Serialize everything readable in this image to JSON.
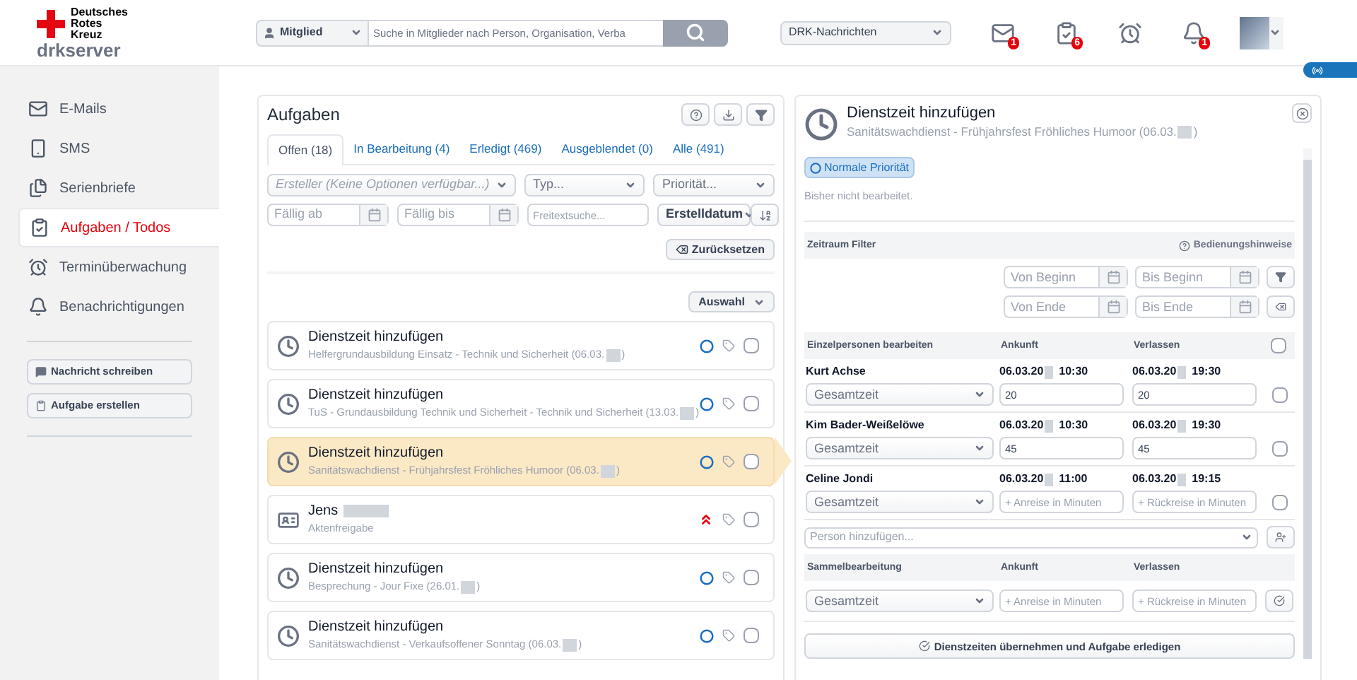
{
  "header": {
    "logo": {
      "lines": [
        "Deutsches",
        "Rotes",
        "Kreuz"
      ],
      "brand": "drkserver"
    },
    "search": {
      "scope": "Mitglied",
      "placeholder": "Suche in Mitglieder nach Person, Organisation, Verba"
    },
    "news_select": "DRK-Nachrichten",
    "notifications": [
      {
        "kind": "mail",
        "badge": "1"
      },
      {
        "kind": "tasks",
        "badge": "6"
      },
      {
        "kind": "alarm"
      },
      {
        "kind": "bell",
        "badge": "1"
      }
    ]
  },
  "sidebar": {
    "items": [
      {
        "kind": "mail",
        "label": "E-Mails",
        "selected": false
      },
      {
        "kind": "sms",
        "label": "SMS",
        "selected": false
      },
      {
        "kind": "letters",
        "label": "Serienbriefe",
        "selected": false
      },
      {
        "kind": "tasks",
        "label": "Aufgaben / Todos",
        "selected": true
      },
      {
        "kind": "alarm",
        "label": "Terminüberwachung",
        "selected": false
      },
      {
        "kind": "bell",
        "label": "Benachrichtigungen",
        "selected": false
      }
    ],
    "buttons": [
      {
        "kind": "message",
        "label": "Nachricht schreiben"
      },
      {
        "kind": "task",
        "label": "Aufgabe erstellen"
      }
    ]
  },
  "tasks": {
    "title": "Aufgaben",
    "tabs": [
      {
        "label": "Offen (18)",
        "selected": true
      },
      {
        "label": "In Bearbeitung (4)",
        "selected": false
      },
      {
        "label": "Erledigt (469)",
        "selected": false
      },
      {
        "label": "Ausgeblendet (0)",
        "selected": false
      },
      {
        "label": "Alle (491)",
        "selected": false
      }
    ],
    "filters": {
      "creator": "Ersteller (Keine Optionen verfügbar...)",
      "type": "Typ...",
      "priority": "Priorität...",
      "due_from_placeholder": "Fällig ab",
      "due_to_placeholder": "Fällig bis",
      "fulltext_placeholder": "Freitextsuche...",
      "sort": "Erstelldatum",
      "reset": "Zurücksetzen"
    },
    "selection": "Auswahl",
    "items": [
      {
        "kind": "time",
        "title": "Dienstzeit hinzufügen",
        "subtitle": "Helfergrundausbildung Einsatz - Technik und Sicherheit (06.03.",
        "subtitle_end": ")",
        "high_priority": false,
        "selected": false,
        "checked": false
      },
      {
        "kind": "time",
        "title": "Dienstzeit hinzufügen",
        "subtitle": "TuS - Grundausbildung Technik und Sicherheit - Technik und Sicherheit (13.03.",
        "subtitle_end": ")",
        "high_priority": false,
        "selected": false,
        "checked": false
      },
      {
        "kind": "time",
        "title": "Dienstzeit hinzufügen",
        "subtitle": "Sanitätswachdienst - Frühjahrsfest Fröhliches Humoor (06.03.",
        "subtitle_end": ")",
        "high_priority": false,
        "selected": true,
        "checked": false
      },
      {
        "kind": "file",
        "title": "Jens",
        "title_redacted": true,
        "subtitle": "Aktenfreigabe",
        "high_priority": true,
        "selected": false,
        "checked": false
      },
      {
        "kind": "time",
        "title": "Dienstzeit hinzufügen",
        "subtitle": "Besprechung - Jour Fixe (26.01.",
        "subtitle_end": ")",
        "high_priority": false,
        "selected": false,
        "checked": false
      },
      {
        "kind": "time",
        "title": "Dienstzeit hinzufügen",
        "subtitle": "Sanitätswachdienst - Verkaufsoffener Sonntag (06.03.",
        "subtitle_end": ")",
        "high_priority": false,
        "selected": false,
        "checked": false
      }
    ]
  },
  "detail": {
    "title": "Dienstzeit hinzufügen",
    "subtitle": "Sanitätswachdienst - Frühjahrsfest Fröhliches Humoor (06.03.",
    "subtitle_end": ")",
    "priority": "Normale Priorität",
    "status": "Bisher nicht bearbeitet.",
    "filter": {
      "title": "Zeitraum Filter",
      "help": "Bedienungshinweise",
      "placeholders": [
        "Von Beginn",
        "Bis Beginn",
        "Von Ende",
        "Bis Ende"
      ]
    },
    "persons": {
      "columns": [
        "Einzelpersonen bearbeiten",
        "Ankunft",
        "Verlassen"
      ],
      "all_checked": false,
      "rows": [
        {
          "name": "Kurt Achse",
          "arrival_date": "06.03.20",
          "arrival_time": "10:30",
          "leave_date": "06.03.20",
          "leave_time": "19:30",
          "mode": "Gesamtzeit",
          "arrival_value": "20",
          "leave_value": "20",
          "checked": false
        },
        {
          "name": "Kim Bader-Weißelöwe",
          "arrival_date": "06.03.20",
          "arrival_time": "10:30",
          "leave_date": "06.03.20",
          "leave_time": "19:30",
          "mode": "Gesamtzeit",
          "arrival_value": "45",
          "leave_value": "45",
          "checked": false
        },
        {
          "name": "Celine Jondi",
          "arrival_date": "06.03.20",
          "arrival_time": "11:00",
          "leave_date": "06.03.20",
          "leave_time": "19:15",
          "mode": "Gesamtzeit",
          "arrival_placeholder": "+ Anreise in Minuten",
          "leave_placeholder": "+ Rückreise in Minuten",
          "checked": false
        }
      ],
      "add_placeholder": "Person hinzufügen..."
    },
    "bulk": {
      "columns": [
        "Sammelbearbeitung",
        "Ankunft",
        "Verlassen"
      ],
      "mode": "Gesamtzeit",
      "arrival_placeholder": "+ Anreise in Minuten",
      "leave_placeholder": "+ Rückreise in Minuten"
    },
    "submit": "Dienstzeiten übernehmen und Aufgabe erledigen"
  }
}
